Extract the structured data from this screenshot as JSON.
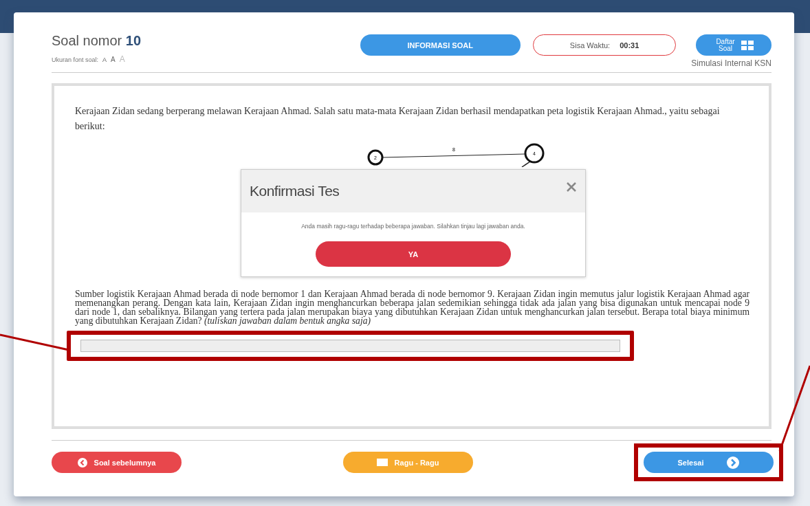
{
  "header": {
    "title": "Soal nomor",
    "number": "10",
    "font_size_label": "Ukuran font soal:",
    "font_sizes": [
      {
        "label": "A",
        "disabled": false
      },
      {
        "label": "A",
        "disabled": false
      },
      {
        "label": "A",
        "disabled": true
      }
    ],
    "info_button": "INFORMASI SOAL",
    "timer_label": "Sisa Waktu:",
    "timer_value": "00:31",
    "list_button": "Daftar Soal",
    "subtitle": "Simulasi Internal KSN"
  },
  "question": {
    "intro": "Kerajaan Zidan sedang berperang melawan Kerajaan Ahmad. Salah satu mata-mata Kerajaan Zidan berhasil mendapatkan peta logistik Kerajaan Ahmad., yaitu sebagai berikut:",
    "graph": {
      "nodes": [
        "2",
        "4"
      ],
      "edge_label": "8"
    },
    "body": "Sumber logistik Kerajaan Ahmad berada di node bernomor 1 dan Kerajaan Ahmad berada di node bernomor 9. Kerajaan Zidan ingin memutus jalur logistik Kerajaan Ahmad agar memenangkan perang. Dengan kata lain, Kerajaan Zidan ingin menghancurkan beberapa jalan sedemikian sehingga tidak ada jalan yang bisa digunakan untuk mencapai node 9 dari node 1, dan sebaliknya. Bilangan yang tertera pada jalan merupakan biaya yang dibutuhkan Kerajaan Zidan untuk menghancurkan jalan tersebut. Berapa total biaya minimum yang dibutuhkan Kerajaan Zidan? *(tuliskan jawaban dalam bentuk angka saja)*"
  },
  "dialog": {
    "title": "Konfirmasi Tes",
    "message": "Anda masih ragu-ragu terhadap beberapa jawaban. Silahkan tinjau lagi jawaban anda.",
    "confirm_button": "YA"
  },
  "footer": {
    "prev_button": "Soal sebelumnya",
    "flag_button": "Ragu - Ragu",
    "finish_button": "Selesai"
  }
}
